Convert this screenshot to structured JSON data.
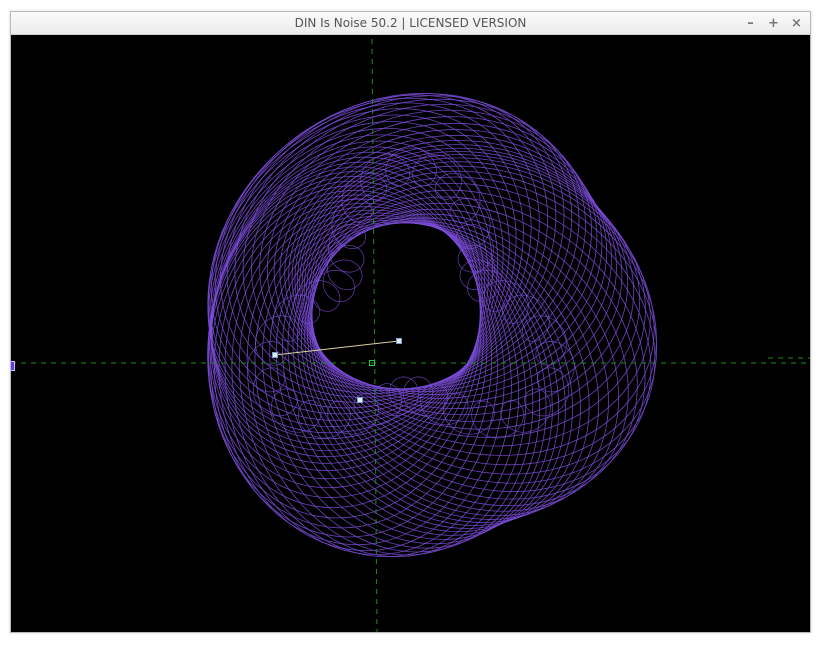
{
  "window": {
    "title": "DIN Is Noise 50.2 | LICENSED VERSION",
    "controls": {
      "minimize": "–",
      "maximize": "+",
      "close": "×"
    }
  },
  "colors": {
    "curve": "#7c4ddb",
    "axis": "#1e8a1e",
    "handle_fill": "#dfeff7",
    "handle_stroke": "#7aa0c8",
    "center": "#22cc44",
    "connector": "#d8d0a8",
    "background": "#000000"
  },
  "icons": [
    "minimize-icon",
    "maximize-icon",
    "close-icon"
  ]
}
